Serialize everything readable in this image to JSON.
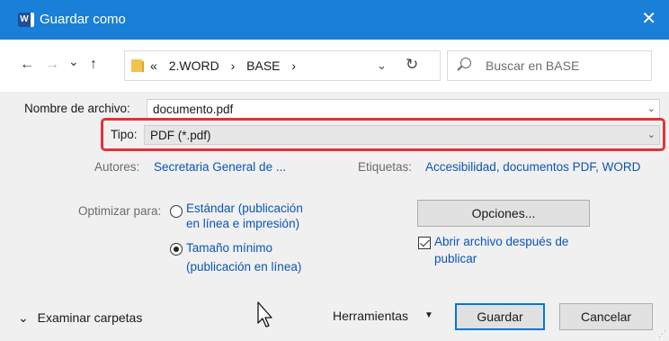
{
  "window": {
    "title": "Guardar como",
    "app_icon_letter": "W",
    "close_glyph": "✕"
  },
  "nav": {
    "back_glyph": "←",
    "forward_glyph": "→",
    "recent_glyph": "⌄",
    "up_glyph": "↑",
    "breadcrumb": [
      "«",
      "2.WORD",
      "›",
      "BASE",
      "›"
    ],
    "dropdown_glyph": "⌄",
    "refresh_glyph": "↻",
    "search_placeholder": "Buscar en BASE"
  },
  "form": {
    "filename_label": "Nombre de archivo:",
    "filename_value": "documento.pdf",
    "type_label": "Tipo:",
    "type_value": "PDF (*.pdf)",
    "authors_label": "Autores:",
    "authors_value": "Secretaria General de ...",
    "tags_label": "Etiquetas:",
    "tags_value": "Accesibilidad, documentos PDF, WORD",
    "optimize_label": "Optimizar para:",
    "option_standard_line1": "Estándar (publicación",
    "option_standard_line2": "en línea e impresión)",
    "option_min_line1": "Tamaño mínimo",
    "option_min_line2": "(publicación en línea)",
    "selected_option": "Tamaño mínimo",
    "options_button": "Opciones...",
    "open_after_line1": "Abrir archivo después de",
    "open_after_line2": "publicar",
    "open_after_checked": true,
    "dropdown_glyph": "⌄"
  },
  "footer": {
    "browse_label": "Examinar carpetas",
    "browse_glyph": "⌄",
    "tools_label": "Herramientas",
    "tools_caret": "▼",
    "save_button": "Guardar",
    "cancel_button": "Cancelar"
  },
  "colors": {
    "titlebar": "#1a7fd6",
    "link": "#0a55b8",
    "highlight": "#e0333b",
    "primary_border": "#0078d7"
  }
}
